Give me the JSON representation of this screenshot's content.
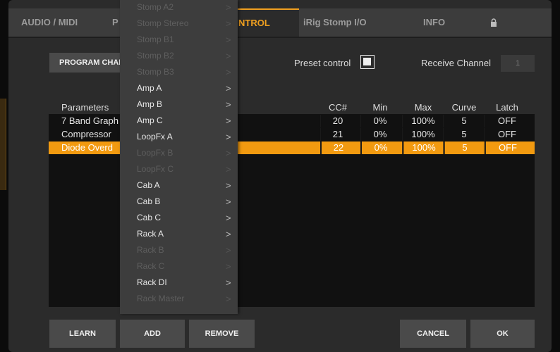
{
  "tabs": {
    "audio_midi": "AUDIO / MIDI",
    "partial_p": "P",
    "control": "NTROL",
    "irig_stomp": "iRig Stomp I/O",
    "info": "INFO"
  },
  "controls": {
    "program_change_label": "PROGRAM CHAN",
    "preset_control_label": "Preset control",
    "preset_control_checked": true,
    "receive_channel_label": "Receive Channel",
    "receive_channel_value": "1"
  },
  "table": {
    "headers": {
      "parameters": "Parameters",
      "cc": "CC#",
      "min": "Min",
      "max": "Max",
      "curve": "Curve",
      "latch": "Latch"
    },
    "rows": [
      {
        "name": "7 Band Graph",
        "cc": "20",
        "min": "0%",
        "max": "100%",
        "curve": "5",
        "latch": "OFF"
      },
      {
        "name": "Compressor",
        "cc": "21",
        "min": "0%",
        "max": "100%",
        "curve": "5",
        "latch": "OFF"
      },
      {
        "name": "Diode Overd",
        "cc": "22",
        "min": "0%",
        "max": "100%",
        "curve": "5",
        "latch": "OFF"
      }
    ]
  },
  "menu": {
    "items": [
      {
        "label": "Stomp A2",
        "enabled": false
      },
      {
        "label": "Stomp Stereo",
        "enabled": false
      },
      {
        "label": "Stomp B1",
        "enabled": false
      },
      {
        "label": "Stomp B2",
        "enabled": false
      },
      {
        "label": "Stomp B3",
        "enabled": false
      },
      {
        "label": "Amp A",
        "enabled": true
      },
      {
        "label": "Amp B",
        "enabled": true
      },
      {
        "label": "Amp C",
        "enabled": true
      },
      {
        "label": "LoopFx A",
        "enabled": true
      },
      {
        "label": "LoopFx B",
        "enabled": false
      },
      {
        "label": "LoopFx C",
        "enabled": false
      },
      {
        "label": "Cab A",
        "enabled": true
      },
      {
        "label": "Cab B",
        "enabled": true
      },
      {
        "label": "Cab C",
        "enabled": true
      },
      {
        "label": "Rack A",
        "enabled": true
      },
      {
        "label": "Rack B",
        "enabled": false
      },
      {
        "label": "Rack C",
        "enabled": false
      },
      {
        "label": "Rack DI",
        "enabled": true
      },
      {
        "label": "Rack Master",
        "enabled": false
      }
    ],
    "chevron": ">"
  },
  "buttons": {
    "learn": "LEARN",
    "add": "ADD",
    "remove": "REMOVE",
    "cancel": "CANCEL",
    "ok": "OK"
  },
  "colors": {
    "accent": "#f29a10",
    "background": "#2b2b2b",
    "table_bg": "#111111"
  },
  "icons": {
    "lock": "lock-icon",
    "check": "checkbox-checked-icon"
  }
}
